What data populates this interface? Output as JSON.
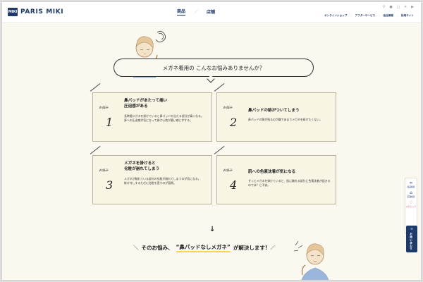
{
  "header": {
    "logo_mark": "MIKI",
    "logo_text": "PARIS MIKI",
    "nav": [
      {
        "label": "商品",
        "active": true
      },
      {
        "label": "店舗",
        "active": false
      }
    ],
    "links": [
      "オンラインショップ",
      "アフターサービス",
      "会社情報",
      "採用サイト"
    ]
  },
  "intro": {
    "bubble_text": "メガネ着用の こんなお悩みありませんか？"
  },
  "worry_label": "お悩み",
  "cards": [
    {
      "num": "1",
      "title": "鼻パッドがあたって痛い\n圧迫感がある",
      "desc": "長時間メガネを掛けていると鼻パッドの当たる部分が痛くなる。\n鼻への圧迫感が気になって掛け心地が悪い感じがする。"
    },
    {
      "num": "2",
      "title": "鼻パッドの跡がついてしまう",
      "desc": "鼻パッドの跡が残るのが嫌であまりメガネを掛けたくない。"
    },
    {
      "num": "3",
      "title": "メガネを掛けると\n化粧が崩れてしまう",
      "desc": "メガネが触れている部分の化粧が崩れてしまうのが気になる。\n掛け外しするたびに化粧を直すのが面倒。"
    },
    {
      "num": "4",
      "title": "肌への色素沈着が気になる",
      "desc": "ずっとメガネを掛けていると、肌に触れる部分に色素沈着が起きるのでは？と不安。"
    }
  ],
  "solution": {
    "arrow": "↓",
    "prefix": "そのお悩み、",
    "highlight": "“鼻パッドなしメガネ”",
    "suffix": "が解決します!"
  },
  "side_tools": [
    {
      "icon": "glasses-icon",
      "label": "商品検索"
    },
    {
      "icon": "store-icon",
      "label": "店舗検索"
    },
    {
      "icon": "heart-icon",
      "label": "お気に入り"
    }
  ],
  "contact_label": "お問い合わせ",
  "colors": {
    "brand": "#1e3a6b",
    "background": "#fbf8ef",
    "card": "#f8f5e4",
    "highlight": "#f5d84c",
    "favorite": "#d2577f"
  }
}
